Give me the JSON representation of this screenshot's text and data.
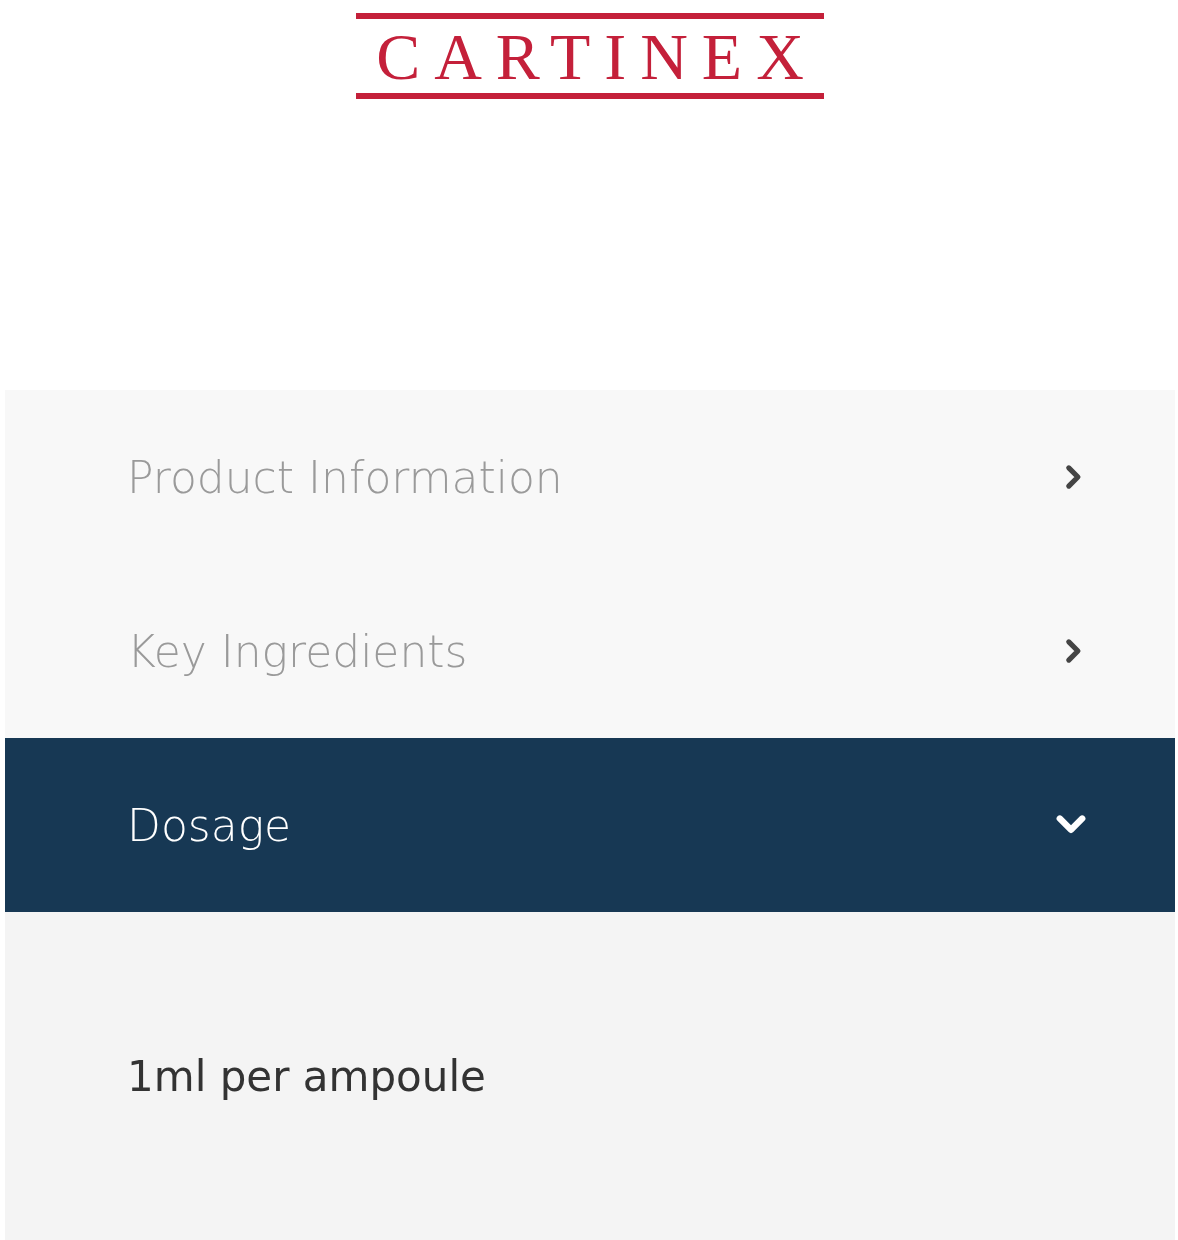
{
  "logo": {
    "text": "CARTINEX"
  },
  "accordion": {
    "items": [
      {
        "label": "Product Information",
        "expanded": false
      },
      {
        "label": "Key Ingredients",
        "expanded": false
      },
      {
        "label": "Dosage",
        "expanded": true
      }
    ],
    "panel": {
      "text": "1ml per ampoule"
    }
  }
}
